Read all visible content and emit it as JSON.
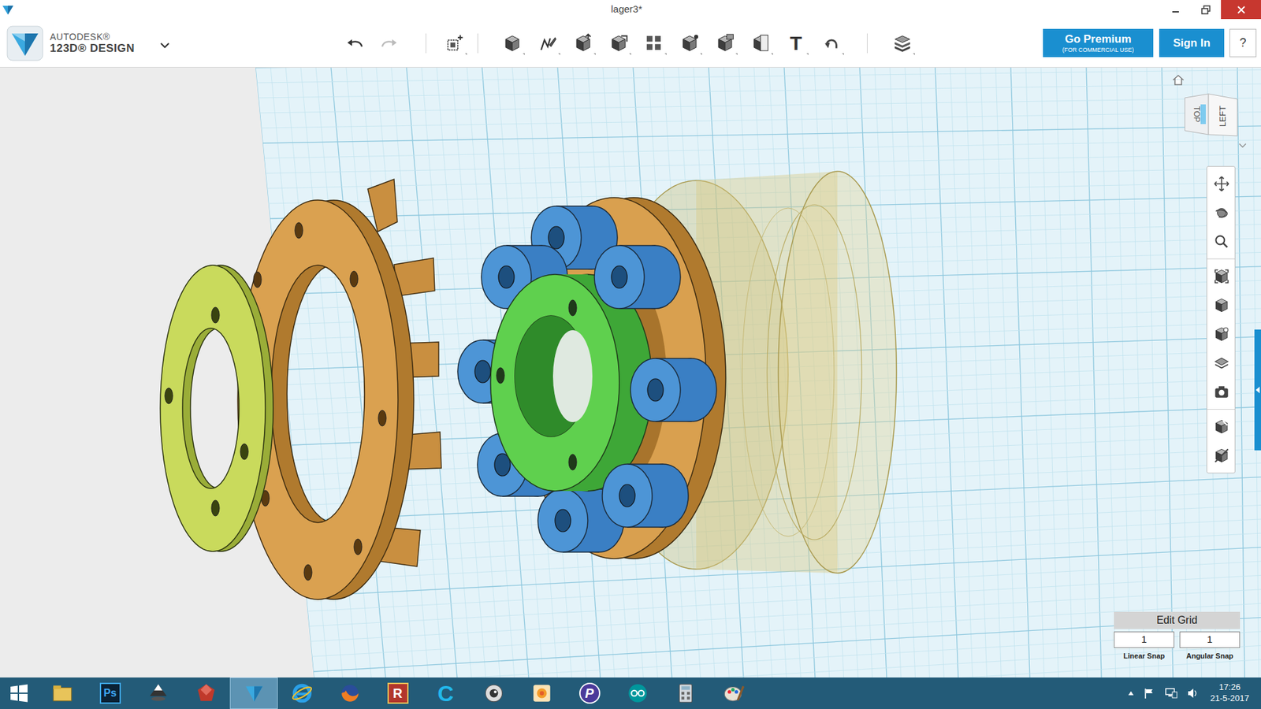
{
  "window": {
    "title": "lager3*"
  },
  "brand": {
    "company": "AUTODESK®",
    "product": "123D® DESIGN"
  },
  "toolbar": {
    "text_tool": "T"
  },
  "account": {
    "premium": "Go Premium",
    "premium_note": "(FOR COMMERCIAL USE)",
    "sign_in": "Sign In",
    "help": "?"
  },
  "view_cube": {
    "front": "LEFT",
    "top": "TOP"
  },
  "edit_grid": {
    "title": "Edit Grid",
    "fields": [
      {
        "label": "Linear Snap",
        "value": "1"
      },
      {
        "label": "Angular Snap",
        "value": "1"
      }
    ]
  },
  "taskbar": {
    "apps": [
      {
        "kind": "explorer",
        "selected": false
      },
      {
        "kind": "photoshop",
        "label": "Ps",
        "selected": false
      },
      {
        "kind": "inkscape",
        "selected": false
      },
      {
        "kind": "gem",
        "selected": false
      },
      {
        "kind": "design123d",
        "selected": true
      },
      {
        "kind": "ie",
        "selected": false
      },
      {
        "kind": "firefox",
        "selected": false
      },
      {
        "kind": "rapp",
        "label": "R",
        "selected": false
      },
      {
        "kind": "capp",
        "label": "C",
        "selected": false
      },
      {
        "kind": "eye",
        "selected": false
      },
      {
        "kind": "flower",
        "selected": false
      },
      {
        "kind": "papp",
        "label": "P",
        "selected": false
      },
      {
        "kind": "arduino",
        "selected": false
      },
      {
        "kind": "calculator",
        "selected": false
      },
      {
        "kind": "paint",
        "selected": false
      }
    ],
    "clock": {
      "time": "17:26",
      "date": "21-5-2017"
    }
  }
}
